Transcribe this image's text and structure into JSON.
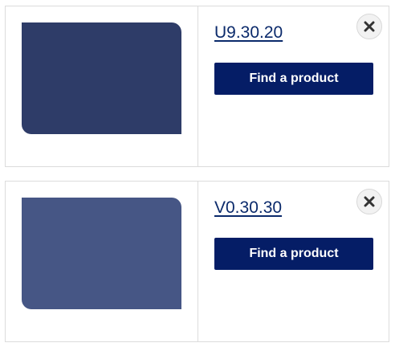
{
  "products": [
    {
      "code": "U9.30.20",
      "color": "#2e3c68",
      "button_label": "Find a product",
      "close_icon": "close-icon"
    },
    {
      "code": "V0.30.30",
      "color": "#465685",
      "button_label": "Find a product",
      "close_icon": "close-icon"
    }
  ],
  "colors": {
    "button_bg": "#051d66",
    "link": "#0b2a6b",
    "border": "#dcdcdc"
  }
}
